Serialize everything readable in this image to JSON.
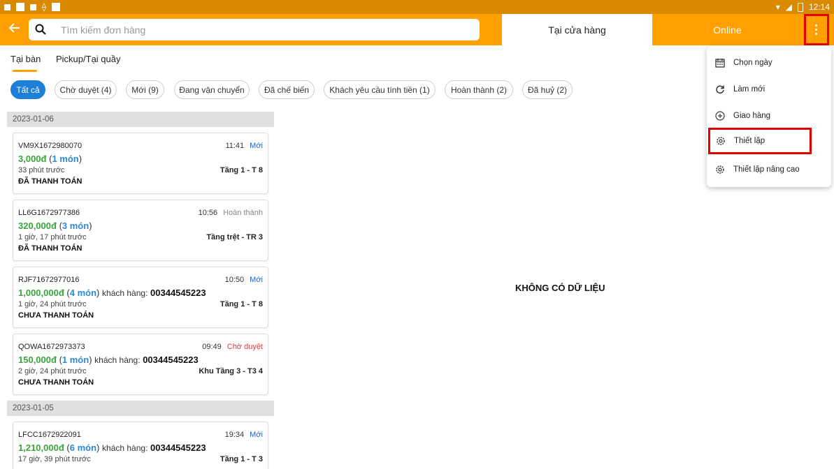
{
  "status_bar": {
    "time": "12:14"
  },
  "app_bar": {
    "search_placeholder": "Tìm kiếm đơn hàng",
    "tabs": [
      {
        "label": "Tại cửa hàng"
      },
      {
        "label": "Online"
      }
    ]
  },
  "sub_tabs": [
    {
      "label": "Tại bàn"
    },
    {
      "label": "Pickup/Tại quầy"
    }
  ],
  "filters": [
    {
      "label": "Tất cả"
    },
    {
      "label": "Chờ duyệt (4)"
    },
    {
      "label": "Mới (9)"
    },
    {
      "label": "Đang vận chuyển"
    },
    {
      "label": "Đã chế biến"
    },
    {
      "label": "Khách yêu cầu tính tiền (1)"
    },
    {
      "label": "Hoàn thành (2)"
    },
    {
      "label": "Đã huỷ (2)"
    }
  ],
  "groups": [
    {
      "date": "2023-01-06",
      "orders": [
        {
          "code": "VM9X1672980070",
          "time": "11:41",
          "status": "Mới",
          "status_color": "#1e5fd6",
          "amount": "3,000đ",
          "items": "1 món",
          "customer_label": "",
          "customer": "",
          "ago": "33 phút trước",
          "table": "Tầng 1 - T 8",
          "payment": "ĐÃ THANH TOÁN"
        },
        {
          "code": "LL6G1672977386",
          "time": "10:56",
          "status": "Hoàn thành",
          "status_color": "#888888",
          "amount": "320,000đ",
          "items": "3 món",
          "customer_label": "",
          "customer": "",
          "ago": "1 giờ, 17 phút trước",
          "table": "Tầng trệt - TR 3",
          "payment": "ĐÃ THANH TOÁN"
        },
        {
          "code": "RJF71672977016",
          "time": "10:50",
          "status": "Mới",
          "status_color": "#1e5fd6",
          "amount": "1,000,000đ",
          "items": "4 món",
          "customer_label": "khách hàng:",
          "customer": "00344545223",
          "ago": "1 giờ, 24 phút trước",
          "table": "Tầng 1 - T 8",
          "payment": "CHƯA THANH TOÁN"
        },
        {
          "code": "QOWA1672973373",
          "time": "09:49",
          "status": "Chờ duyệt",
          "status_color": "#e0393e",
          "amount": "150,000đ",
          "items": "1 món",
          "customer_label": "khách hàng:",
          "customer": "00344545223",
          "ago": "2 giờ, 24 phút trước",
          "table": "Khu Tầng 3 - T3 4",
          "payment": "CHƯA THANH TOÁN"
        }
      ]
    },
    {
      "date": "2023-01-05",
      "orders": [
        {
          "code": "LFCC1672922091",
          "time": "19:34",
          "status": "Mới",
          "status_color": "#1e5fd6",
          "amount": "1,210,000đ",
          "items": "6 món",
          "customer_label": "khách hàng:",
          "customer": "00344545223",
          "ago": "17 giờ, 39 phút trước",
          "table": "Tầng 1 - T 3",
          "payment": ""
        }
      ]
    }
  ],
  "empty_message": "KHÔNG CÓ DỮ LIỆU",
  "menu": {
    "items": [
      {
        "label": "Chọn ngày",
        "icon": "calendar-icon"
      },
      {
        "label": "Làm mới",
        "icon": "refresh-icon"
      },
      {
        "label": "Giao hàng",
        "icon": "add-circle-icon"
      },
      {
        "label": "Thiết lập",
        "icon": "gear-icon"
      },
      {
        "label": "Thiết lập nâng cao",
        "icon": "gear-icon"
      }
    ]
  },
  "colors": {
    "accent": "#ffa000",
    "status_bar": "#d98a00",
    "active_chip": "#1e7fd6",
    "amount": "#3aa53a",
    "highlight": "#e50000"
  }
}
